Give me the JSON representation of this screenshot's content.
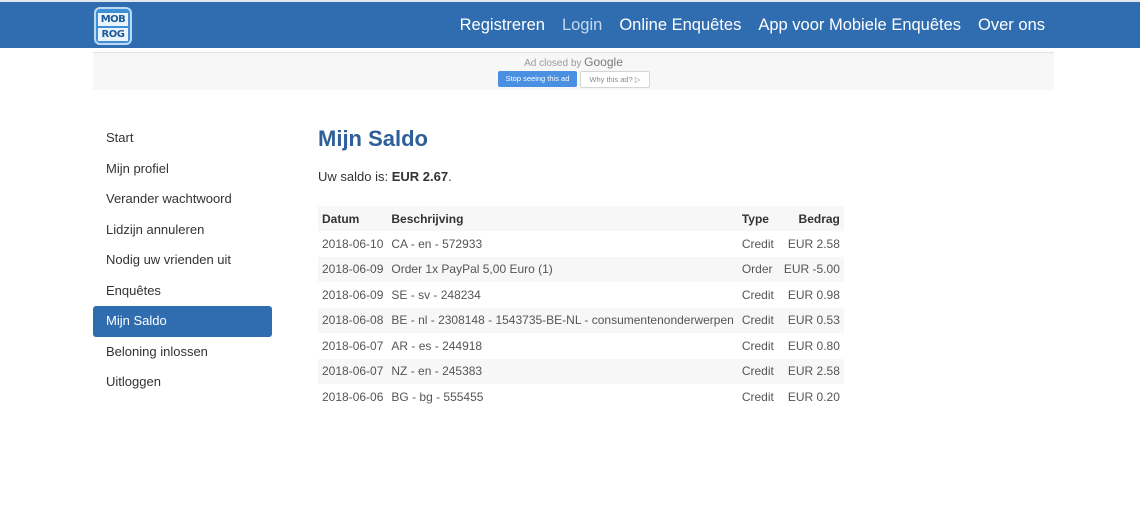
{
  "header": {
    "logo_top": "MOB",
    "logo_bottom": "ROG",
    "nav": [
      {
        "label": "Registreren"
      },
      {
        "label": "Login"
      },
      {
        "label": "Online Enquêtes"
      },
      {
        "label": "App voor Mobiele Enquêtes"
      },
      {
        "label": "Over ons"
      }
    ]
  },
  "ad": {
    "closed_by": "Ad closed by",
    "google": "Google",
    "stop_label": "Stop seeing this ad",
    "why_label": "Why this ad? ▷"
  },
  "sidebar": {
    "items": [
      {
        "label": "Start"
      },
      {
        "label": "Mijn profiel"
      },
      {
        "label": "Verander wachtwoord"
      },
      {
        "label": "Lidzijn annuleren"
      },
      {
        "label": "Nodig uw vrienden uit"
      },
      {
        "label": "Enquêtes"
      },
      {
        "label": "Mijn Saldo"
      },
      {
        "label": "Beloning inlossen"
      },
      {
        "label": "Uitloggen"
      }
    ]
  },
  "main": {
    "title": "Mijn Saldo",
    "balance_prefix": "Uw saldo is: ",
    "balance_value": "EUR 2.67",
    "balance_suffix": ".",
    "table": {
      "headers": [
        "Datum",
        "Beschrijving",
        "Type",
        "Bedrag"
      ],
      "rows": [
        {
          "date": "2018-06-10",
          "desc": "CA - en - 572933",
          "type": "Credit",
          "amount": "EUR 2.58"
        },
        {
          "date": "2018-06-09",
          "desc": "Order 1x PayPal 5,00 Euro (1)",
          "type": "Order",
          "amount": "EUR -5.00"
        },
        {
          "date": "2018-06-09",
          "desc": "SE - sv - 248234",
          "type": "Credit",
          "amount": "EUR 0.98"
        },
        {
          "date": "2018-06-08",
          "desc": "BE - nl - 2308148 - 1543735-BE-NL - consumentenonderwerpen",
          "type": "Credit",
          "amount": "EUR 0.53"
        },
        {
          "date": "2018-06-07",
          "desc": "AR - es - 244918",
          "type": "Credit",
          "amount": "EUR 0.80"
        },
        {
          "date": "2018-06-07",
          "desc": "NZ - en - 245383",
          "type": "Credit",
          "amount": "EUR 2.58"
        },
        {
          "date": "2018-06-06",
          "desc": "BG - bg - 555455",
          "type": "Credit",
          "amount": "EUR 0.20"
        }
      ]
    }
  }
}
